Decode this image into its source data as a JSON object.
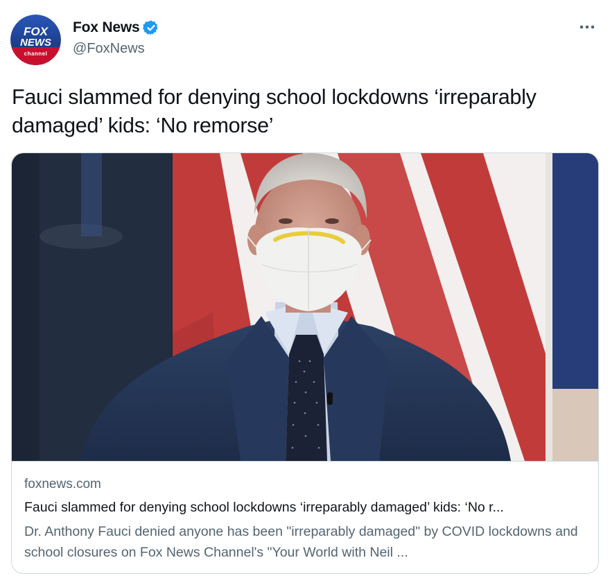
{
  "author": {
    "display_name": "Fox News",
    "handle": "@FoxNews",
    "logo_text": "FOX NEWS channel",
    "verified": true
  },
  "menu": {
    "icon": "more-horizontal-icon"
  },
  "tweet": {
    "text": "Fauci slammed for denying school lockdowns ‘irreparably damaged’ kids: ‘No remorse’"
  },
  "card": {
    "image": "photo-man-in-mask-before-flag",
    "domain": "foxnews.com",
    "title": "Fauci slammed for denying school lockdowns ‘irreparably damaged’ kids: ‘No r...",
    "description": "Dr. Anthony Fauci denied anyone has been \"irreparably damaged\" by COVID lockdowns and school closures on Fox News Channel's \"Your World with Neil ..."
  },
  "colors": {
    "text_primary": "#0f1419",
    "text_secondary": "#536471",
    "verified_blue": "#1d9bf0",
    "border": "#cfd9de",
    "logo_blue": "#1c3f94",
    "logo_red": "#c8102e"
  }
}
